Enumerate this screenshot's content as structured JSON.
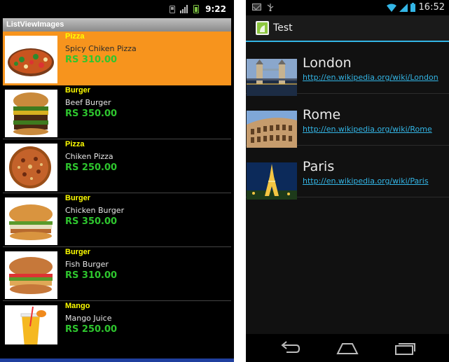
{
  "left_phone": {
    "status": {
      "time": "9:22"
    },
    "title": "ListViewImages",
    "items": [
      {
        "category": "Pizza",
        "name": "Spicy Chiken Pizza",
        "price": "RS 310.00",
        "image": "spicy-pizza-image",
        "selected": true
      },
      {
        "category": "Burger",
        "name": "Beef Burger",
        "price": "RS 350.00",
        "image": "beef-burger-image"
      },
      {
        "category": "Pizza",
        "name": "Chiken Pizza",
        "price": "RS 250.00",
        "image": "chicken-pizza-image"
      },
      {
        "category": "Burger",
        "name": "Chicken Burger",
        "price": "RS 350.00",
        "image": "chicken-burger-image"
      },
      {
        "category": "Burger",
        "name": "Fish Burger",
        "price": "RS 310.00",
        "image": "fish-burger-image"
      },
      {
        "category": "Mango",
        "name": "Mango Juice",
        "price": "RS 250.00",
        "image": "mango-juice-image"
      }
    ]
  },
  "right_phone": {
    "status": {
      "time": "16:52"
    },
    "title": "Test",
    "items": [
      {
        "name": "London",
        "link": "http://en.wikipedia.org/wiki/London",
        "image": "tower-bridge-image"
      },
      {
        "name": "Rome",
        "link": "http://en.wikipedia.org/wiki/Rome",
        "image": "colosseum-image"
      },
      {
        "name": "Paris",
        "link": "http://en.wikipedia.org/wiki/Paris",
        "image": "eiffel-tower-image"
      }
    ],
    "nav": [
      "back-icon",
      "home-icon",
      "recent-apps-icon"
    ]
  },
  "colors": {
    "selection": "#f7941d",
    "category": "#ffff00",
    "price": "#2ec62e",
    "holo_blue": "#33b5e5"
  }
}
